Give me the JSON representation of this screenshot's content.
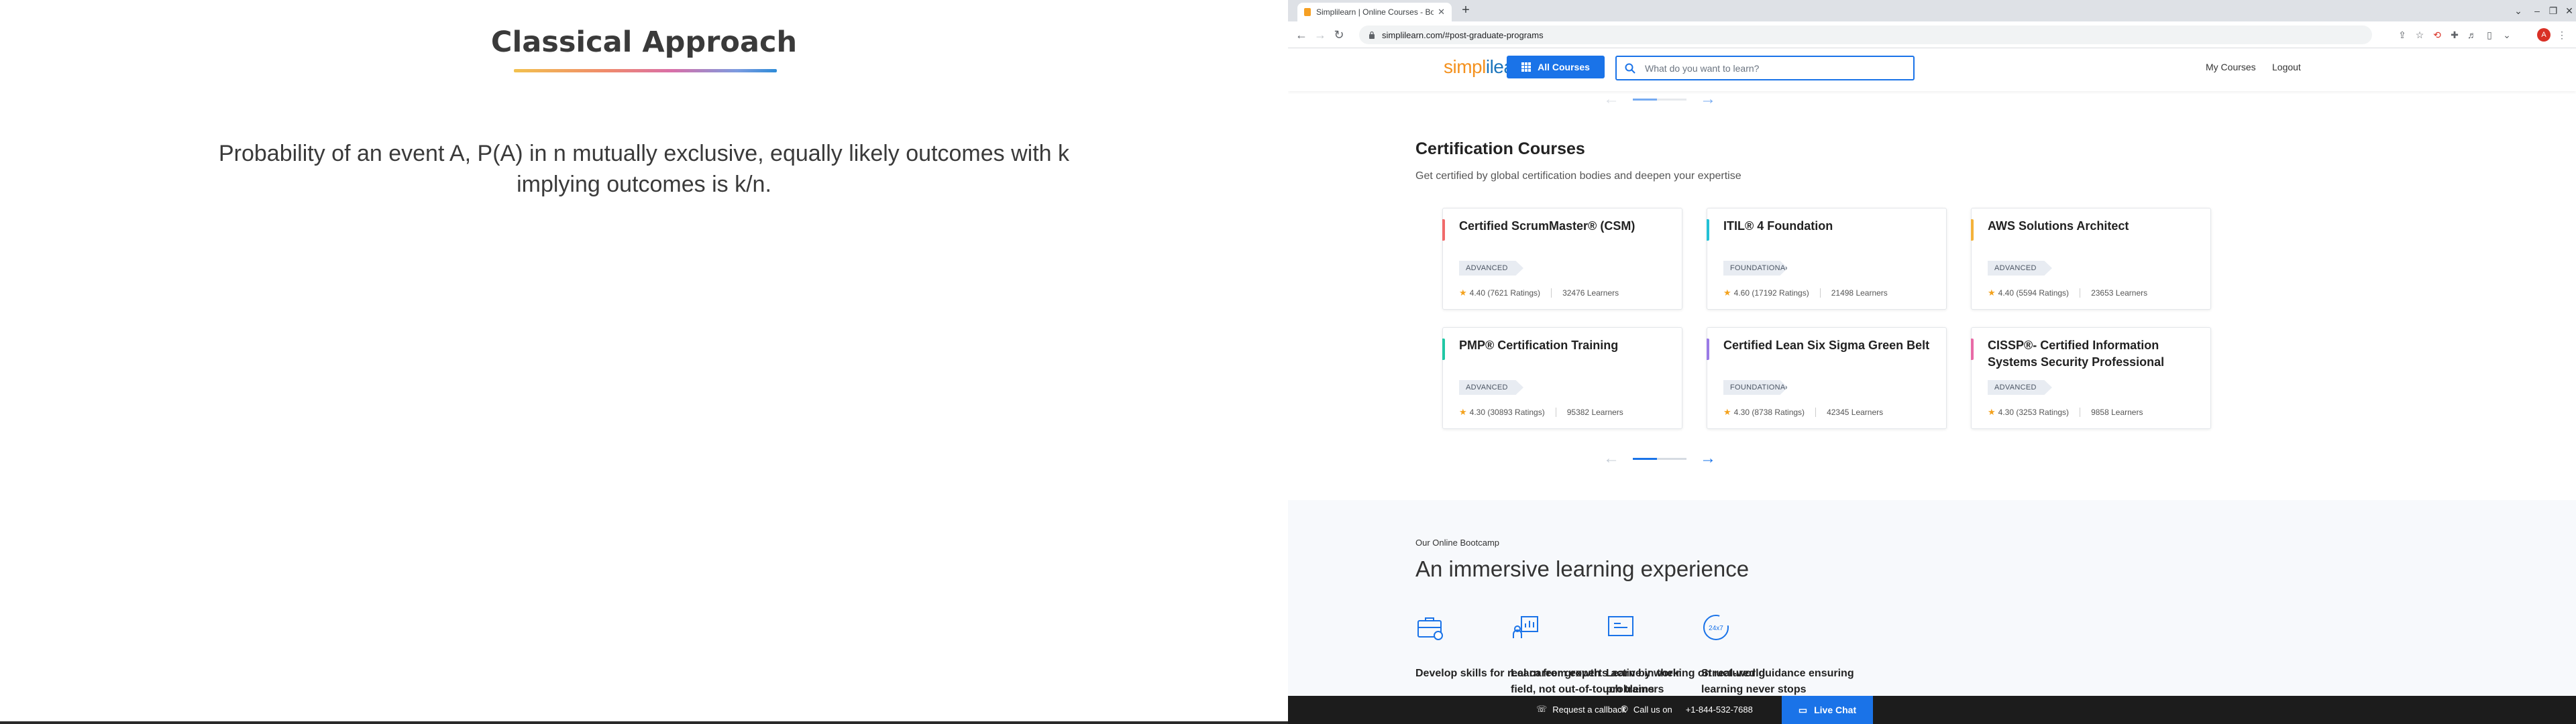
{
  "slide": {
    "title": "Classical Approach",
    "body": "Probability of an event A, P(A) in n mutually exclusive, equally likely outcomes with k implying outcomes is k/n."
  },
  "browser": {
    "tab_title": "Simplilearn | Online Courses - Bo",
    "url": "simplilearn.com/#post-graduate-programs",
    "profile_initial": "A"
  },
  "site": {
    "logo_part1": "simpl",
    "logo_part2": "ilearn",
    "all_courses": "All Courses",
    "search_placeholder": "What do you want to learn?",
    "my_courses": "My Courses",
    "logout": "Logout"
  },
  "certification": {
    "title": "Certification Courses",
    "subtitle": "Get certified by global certification bodies and deepen your expertise",
    "cards": [
      {
        "title": "Certified ScrumMaster® (CSM)",
        "badge": "ADVANCED",
        "rating": "4.40 (7621 Ratings)",
        "learners": "32476 Learners",
        "accent": "#f06a6a"
      },
      {
        "title": "ITIL® 4 Foundation",
        "badge": "FOUNDATIONAL",
        "rating": "4.60 (17192 Ratings)",
        "learners": "21498 Learners",
        "accent": "#22c1d6"
      },
      {
        "title": "AWS Solutions Architect",
        "badge": "ADVANCED",
        "rating": "4.40 (5594 Ratings)",
        "learners": "23653 Learners",
        "accent": "#f4b23a"
      },
      {
        "title": "PMP® Certification Training",
        "badge": "ADVANCED",
        "rating": "4.30 (30893 Ratings)",
        "learners": "95382 Learners",
        "accent": "#1fc7a4"
      },
      {
        "title": "Certified Lean Six Sigma Green Belt",
        "badge": "FOUNDATIONAL",
        "rating": "4.30 (8738 Ratings)",
        "learners": "42345 Learners",
        "accent": "#9a7be6"
      },
      {
        "title": "CISSP®- Certified Information Systems Security Professional",
        "badge": "ADVANCED",
        "rating": "4.30 (3253 Ratings)",
        "learners": "9858 Learners",
        "accent": "#e86aa6"
      }
    ]
  },
  "bootcamp": {
    "kicker": "Our Online Bootcamp",
    "title": "An immersive learning experience",
    "features": [
      {
        "label": "Develop skills for real career growth",
        "icon": "briefcase-icon"
      },
      {
        "label": "Learn from experts active in their field, not out-of-touch trainers",
        "icon": "expert-chart-icon"
      },
      {
        "label": "Learn by working on real-world problems",
        "icon": "board-icon"
      },
      {
        "label": "Structured guidance ensuring learning never stops",
        "icon": "24x7-icon"
      }
    ],
    "badge_247": "24x7"
  },
  "bottom_bar": {
    "callback": "Request a callback",
    "call_us": "Call us on",
    "phone": "+1-844-532-7688",
    "live_chat": "Live Chat"
  },
  "colors": {
    "brand_blue": "#1a73e8",
    "logo_orange": "#f4911e",
    "bottom_bar": "#1c1c1c"
  }
}
